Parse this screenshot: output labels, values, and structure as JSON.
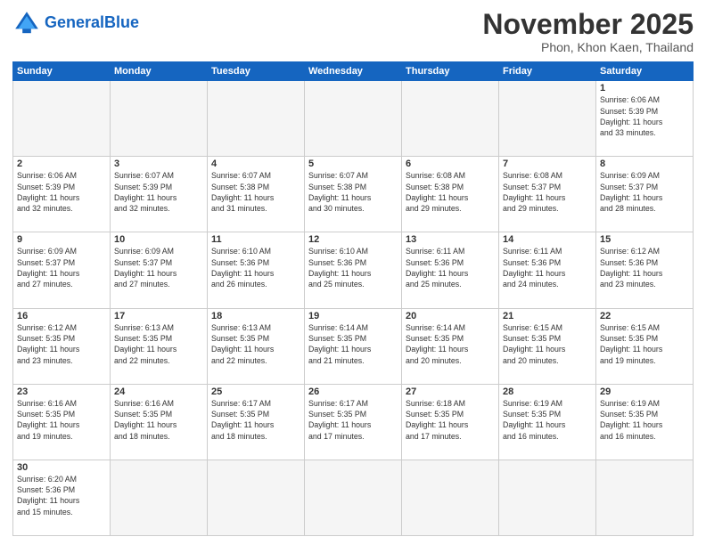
{
  "header": {
    "logo_general": "General",
    "logo_blue": "Blue",
    "month_title": "November 2025",
    "subtitle": "Phon, Khon Kaen, Thailand"
  },
  "weekdays": [
    "Sunday",
    "Monday",
    "Tuesday",
    "Wednesday",
    "Thursday",
    "Friday",
    "Saturday"
  ],
  "weeks": [
    [
      {
        "day": "",
        "info": "",
        "empty": true
      },
      {
        "day": "",
        "info": "",
        "empty": true
      },
      {
        "day": "",
        "info": "",
        "empty": true
      },
      {
        "day": "",
        "info": "",
        "empty": true
      },
      {
        "day": "",
        "info": "",
        "empty": true
      },
      {
        "day": "",
        "info": "",
        "empty": true
      },
      {
        "day": "1",
        "info": "Sunrise: 6:06 AM\nSunset: 5:39 PM\nDaylight: 11 hours\nand 33 minutes.",
        "empty": false
      }
    ],
    [
      {
        "day": "2",
        "info": "Sunrise: 6:06 AM\nSunset: 5:39 PM\nDaylight: 11 hours\nand 32 minutes.",
        "empty": false
      },
      {
        "day": "3",
        "info": "Sunrise: 6:07 AM\nSunset: 5:39 PM\nDaylight: 11 hours\nand 32 minutes.",
        "empty": false
      },
      {
        "day": "4",
        "info": "Sunrise: 6:07 AM\nSunset: 5:38 PM\nDaylight: 11 hours\nand 31 minutes.",
        "empty": false
      },
      {
        "day": "5",
        "info": "Sunrise: 6:07 AM\nSunset: 5:38 PM\nDaylight: 11 hours\nand 30 minutes.",
        "empty": false
      },
      {
        "day": "6",
        "info": "Sunrise: 6:08 AM\nSunset: 5:38 PM\nDaylight: 11 hours\nand 29 minutes.",
        "empty": false
      },
      {
        "day": "7",
        "info": "Sunrise: 6:08 AM\nSunset: 5:37 PM\nDaylight: 11 hours\nand 29 minutes.",
        "empty": false
      },
      {
        "day": "8",
        "info": "Sunrise: 6:09 AM\nSunset: 5:37 PM\nDaylight: 11 hours\nand 28 minutes.",
        "empty": false
      }
    ],
    [
      {
        "day": "9",
        "info": "Sunrise: 6:09 AM\nSunset: 5:37 PM\nDaylight: 11 hours\nand 27 minutes.",
        "empty": false
      },
      {
        "day": "10",
        "info": "Sunrise: 6:09 AM\nSunset: 5:37 PM\nDaylight: 11 hours\nand 27 minutes.",
        "empty": false
      },
      {
        "day": "11",
        "info": "Sunrise: 6:10 AM\nSunset: 5:36 PM\nDaylight: 11 hours\nand 26 minutes.",
        "empty": false
      },
      {
        "day": "12",
        "info": "Sunrise: 6:10 AM\nSunset: 5:36 PM\nDaylight: 11 hours\nand 25 minutes.",
        "empty": false
      },
      {
        "day": "13",
        "info": "Sunrise: 6:11 AM\nSunset: 5:36 PM\nDaylight: 11 hours\nand 25 minutes.",
        "empty": false
      },
      {
        "day": "14",
        "info": "Sunrise: 6:11 AM\nSunset: 5:36 PM\nDaylight: 11 hours\nand 24 minutes.",
        "empty": false
      },
      {
        "day": "15",
        "info": "Sunrise: 6:12 AM\nSunset: 5:36 PM\nDaylight: 11 hours\nand 23 minutes.",
        "empty": false
      }
    ],
    [
      {
        "day": "16",
        "info": "Sunrise: 6:12 AM\nSunset: 5:35 PM\nDaylight: 11 hours\nand 23 minutes.",
        "empty": false
      },
      {
        "day": "17",
        "info": "Sunrise: 6:13 AM\nSunset: 5:35 PM\nDaylight: 11 hours\nand 22 minutes.",
        "empty": false
      },
      {
        "day": "18",
        "info": "Sunrise: 6:13 AM\nSunset: 5:35 PM\nDaylight: 11 hours\nand 22 minutes.",
        "empty": false
      },
      {
        "day": "19",
        "info": "Sunrise: 6:14 AM\nSunset: 5:35 PM\nDaylight: 11 hours\nand 21 minutes.",
        "empty": false
      },
      {
        "day": "20",
        "info": "Sunrise: 6:14 AM\nSunset: 5:35 PM\nDaylight: 11 hours\nand 20 minutes.",
        "empty": false
      },
      {
        "day": "21",
        "info": "Sunrise: 6:15 AM\nSunset: 5:35 PM\nDaylight: 11 hours\nand 20 minutes.",
        "empty": false
      },
      {
        "day": "22",
        "info": "Sunrise: 6:15 AM\nSunset: 5:35 PM\nDaylight: 11 hours\nand 19 minutes.",
        "empty": false
      }
    ],
    [
      {
        "day": "23",
        "info": "Sunrise: 6:16 AM\nSunset: 5:35 PM\nDaylight: 11 hours\nand 19 minutes.",
        "empty": false
      },
      {
        "day": "24",
        "info": "Sunrise: 6:16 AM\nSunset: 5:35 PM\nDaylight: 11 hours\nand 18 minutes.",
        "empty": false
      },
      {
        "day": "25",
        "info": "Sunrise: 6:17 AM\nSunset: 5:35 PM\nDaylight: 11 hours\nand 18 minutes.",
        "empty": false
      },
      {
        "day": "26",
        "info": "Sunrise: 6:17 AM\nSunset: 5:35 PM\nDaylight: 11 hours\nand 17 minutes.",
        "empty": false
      },
      {
        "day": "27",
        "info": "Sunrise: 6:18 AM\nSunset: 5:35 PM\nDaylight: 11 hours\nand 17 minutes.",
        "empty": false
      },
      {
        "day": "28",
        "info": "Sunrise: 6:19 AM\nSunset: 5:35 PM\nDaylight: 11 hours\nand 16 minutes.",
        "empty": false
      },
      {
        "day": "29",
        "info": "Sunrise: 6:19 AM\nSunset: 5:35 PM\nDaylight: 11 hours\nand 16 minutes.",
        "empty": false
      }
    ],
    [
      {
        "day": "30",
        "info": "Sunrise: 6:20 AM\nSunset: 5:36 PM\nDaylight: 11 hours\nand 15 minutes.",
        "empty": false
      },
      {
        "day": "",
        "info": "",
        "empty": true
      },
      {
        "day": "",
        "info": "",
        "empty": true
      },
      {
        "day": "",
        "info": "",
        "empty": true
      },
      {
        "day": "",
        "info": "",
        "empty": true
      },
      {
        "day": "",
        "info": "",
        "empty": true
      },
      {
        "day": "",
        "info": "",
        "empty": true
      }
    ]
  ]
}
